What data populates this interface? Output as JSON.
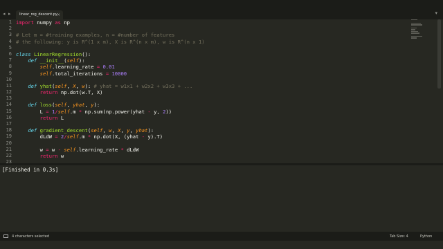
{
  "tabbar": {
    "nav_prev": "◂",
    "nav_next": "▸",
    "tab_label": "linear_reg_descent.py",
    "tab_close": "×",
    "menu_icon": "▾"
  },
  "editor": {
    "line_numbers": [
      "1",
      "2",
      "3",
      "4",
      "5",
      "6",
      "7",
      "8",
      "9",
      "10",
      "11",
      "12",
      "13",
      "14",
      "15",
      "16",
      "17",
      "18",
      "19",
      "20",
      "21",
      "22",
      "23"
    ]
  },
  "output": {
    "text": "[Finished in 0.3s]"
  },
  "statusbar": {
    "selection": "4 characters selected",
    "tab_size": "Tab Size: 4",
    "syntax": "Python"
  },
  "colors": {
    "background": "#272822",
    "keyword": "#f92672",
    "function": "#a6e22e",
    "number": "#ae81ff",
    "comment": "#75715e",
    "self": "#fd971f",
    "storage": "#66d9ef"
  }
}
